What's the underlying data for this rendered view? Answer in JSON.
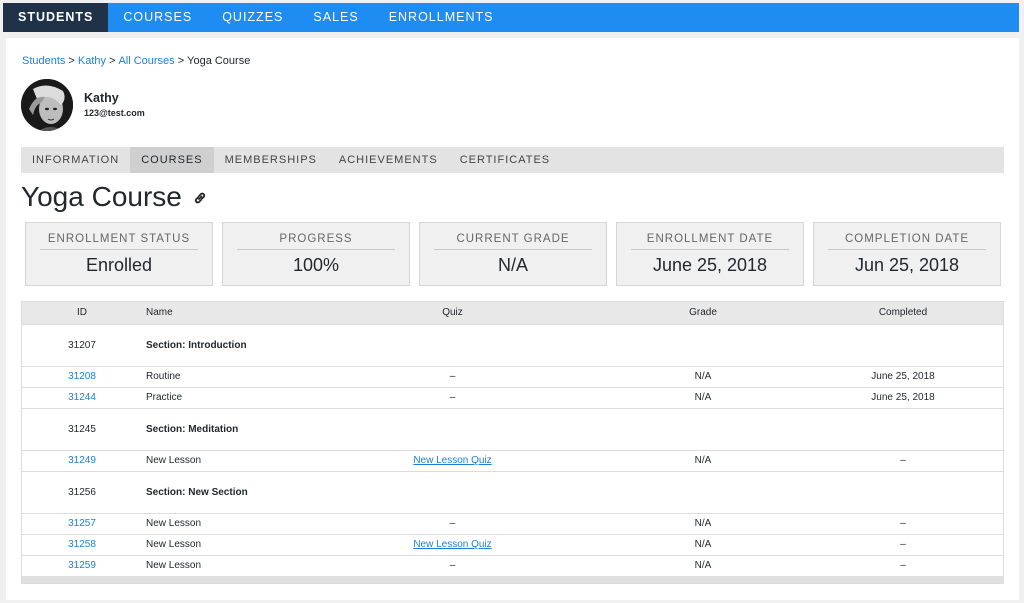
{
  "topnav": {
    "items": [
      {
        "label": "STUDENTS",
        "active": true
      },
      {
        "label": "COURSES",
        "active": false
      },
      {
        "label": "QUIZZES",
        "active": false
      },
      {
        "label": "SALES",
        "active": false
      },
      {
        "label": "ENROLLMENTS",
        "active": false
      }
    ]
  },
  "breadcrumb": {
    "items": [
      "Students",
      "Kathy",
      "All Courses"
    ],
    "current": "Yoga Course",
    "separator": ">"
  },
  "student": {
    "name": "Kathy",
    "email": "123@test.com"
  },
  "subtabs": [
    {
      "label": "INFORMATION",
      "active": false
    },
    {
      "label": "COURSES",
      "active": true
    },
    {
      "label": "MEMBERSHIPS",
      "active": false
    },
    {
      "label": "ACHIEVEMENTS",
      "active": false
    },
    {
      "label": "CERTIFICATES",
      "active": false
    }
  ],
  "course": {
    "title": "Yoga Course"
  },
  "stats": [
    {
      "label": "ENROLLMENT STATUS",
      "value": "Enrolled"
    },
    {
      "label": "PROGRESS",
      "value": "100%"
    },
    {
      "label": "CURRENT GRADE",
      "value": "N/A"
    },
    {
      "label": "ENROLLMENT DATE",
      "value": "June 25, 2018"
    },
    {
      "label": "COMPLETION DATE",
      "value": "Jun 25, 2018"
    }
  ],
  "table": {
    "headers": [
      "ID",
      "Name",
      "Quiz",
      "Grade",
      "Completed"
    ],
    "rows": [
      {
        "type": "section",
        "id": "31207",
        "name": "Section: Introduction"
      },
      {
        "type": "lesson",
        "id": "31208",
        "name": "Routine",
        "quiz": "–",
        "grade": "N/A",
        "completed": "June 25, 2018"
      },
      {
        "type": "lesson",
        "id": "31244",
        "name": "Practice",
        "quiz": "–",
        "grade": "N/A",
        "completed": "June 25, 2018"
      },
      {
        "type": "section",
        "id": "31245",
        "name": "Section: Meditation"
      },
      {
        "type": "lesson",
        "id": "31249",
        "name": "New Lesson",
        "quiz": "New Lesson Quiz",
        "grade": "N/A",
        "completed": "–"
      },
      {
        "type": "section",
        "id": "31256",
        "name": "Section: New Section"
      },
      {
        "type": "lesson",
        "id": "31257",
        "name": "New Lesson",
        "quiz": "–",
        "grade": "N/A",
        "completed": "–"
      },
      {
        "type": "lesson",
        "id": "31258",
        "name": "New Lesson",
        "quiz": "New Lesson Quiz",
        "grade": "N/A",
        "completed": "–"
      },
      {
        "type": "lesson",
        "id": "31259",
        "name": "New Lesson",
        "quiz": "–",
        "grade": "N/A",
        "completed": "–"
      }
    ]
  },
  "colors": {
    "nav_bg": "#1e8cf0",
    "nav_active_bg": "#1f3247",
    "link": "#1e7fd2"
  }
}
